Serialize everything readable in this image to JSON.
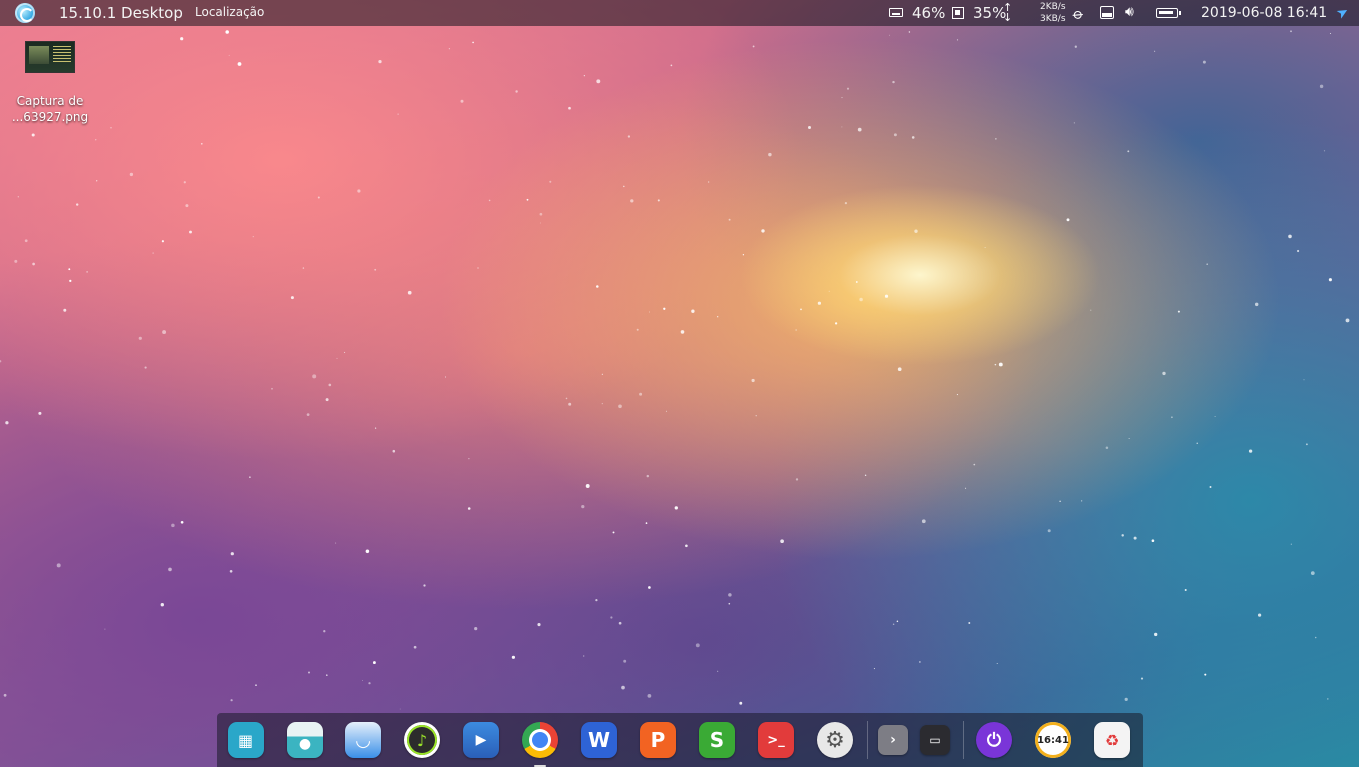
{
  "topbar": {
    "title": "15.10.1 Desktop",
    "place": "Localização",
    "mem_percent": "46%",
    "cpu_percent": "35%",
    "net_up": "2KB/s",
    "net_down": "3KB/s",
    "datetime": "2019-06-08 16:41"
  },
  "desktop": {
    "file_label_line1": "Captura de",
    "file_label_line2": "...63927.png"
  },
  "dock": {
    "clock_glyph": "16:41",
    "colors": {
      "launcher": "#2aa7c9",
      "file_manager": "#3bb4c1",
      "browser_deepin": "#3a8fe8",
      "music": "#2c2c2c",
      "video": "#2f6ec2",
      "chrome": "#ffffff",
      "wps_writer": "#2e63d6",
      "wps_presentation": "#f26322",
      "wps_spreadsheet": "#3aaa35",
      "terminal": "#e23b3b",
      "settings": "#e8e8e8",
      "power": "#7a35d8",
      "clock": "#ffffff",
      "trash": "#f4f4f4"
    }
  }
}
